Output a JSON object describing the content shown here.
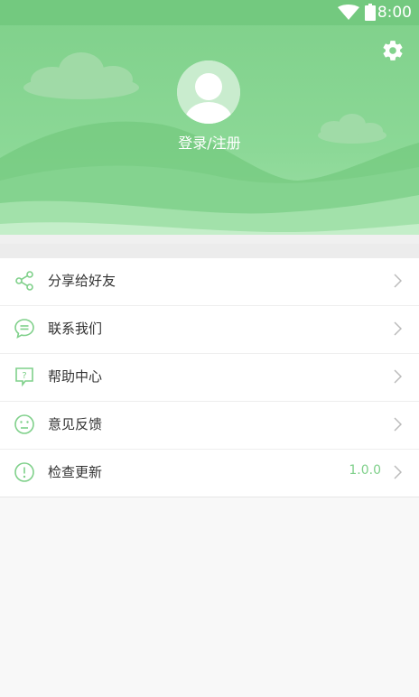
{
  "status_bar": {
    "time": "8:00",
    "wifi_icon": "wifi-icon",
    "battery_icon": "battery-icon"
  },
  "header": {
    "settings_icon": "gear-icon",
    "avatar_icon": "user-avatar-icon",
    "login_label": "登录/注册"
  },
  "menu": {
    "items": [
      {
        "label": "分享给好友",
        "icon": "share-icon",
        "value": ""
      },
      {
        "label": "联系我们",
        "icon": "chat-bubble-icon",
        "value": ""
      },
      {
        "label": "帮助中心",
        "icon": "help-icon",
        "value": ""
      },
      {
        "label": "意见反馈",
        "icon": "feedback-face-icon",
        "value": ""
      },
      {
        "label": "检查更新",
        "icon": "info-alert-icon",
        "value": "1.0.0"
      }
    ]
  },
  "colors": {
    "accent": "#7fd08a",
    "header_top": "#73c97f",
    "background": "#f8f8f8"
  }
}
